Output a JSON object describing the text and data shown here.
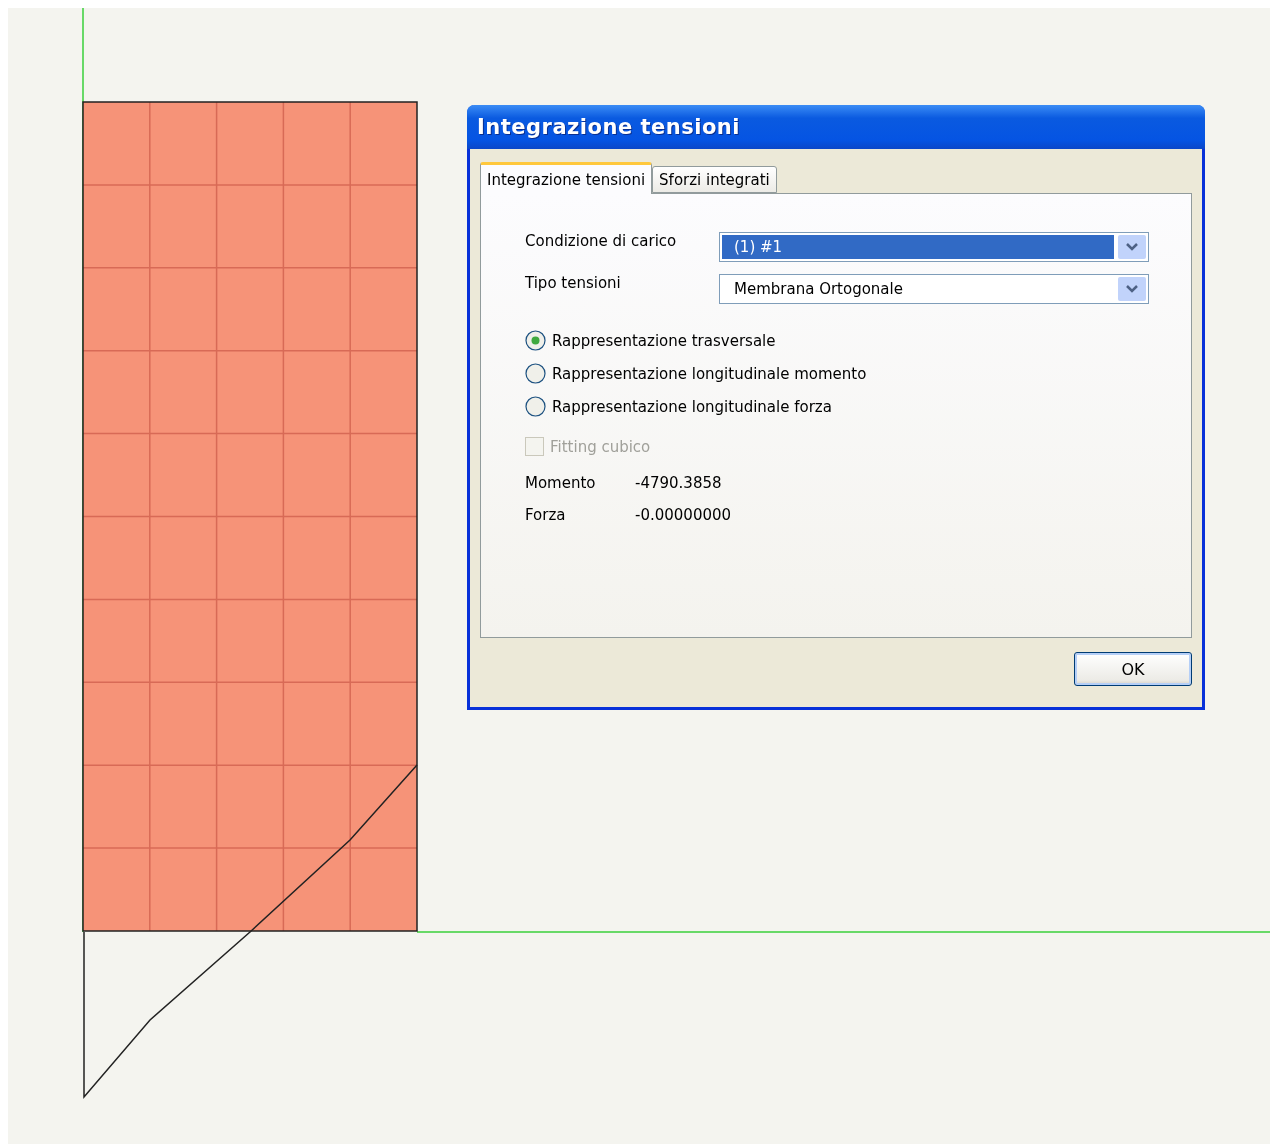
{
  "dialog": {
    "title": "Integrazione tensioni",
    "tabs": [
      {
        "label": "Integrazione tensioni",
        "selected": true
      },
      {
        "label": "Sforzi integrati",
        "selected": false
      }
    ],
    "dropdowns": [
      {
        "label": "Condizione di carico",
        "value": "(1) #1",
        "focused": true
      },
      {
        "label": "Tipo tensioni",
        "value": "Membrana Ortogonale",
        "focused": false
      }
    ],
    "options": [
      {
        "label": "Rappresentazione trasversale",
        "selected": true
      },
      {
        "label": "Rappresentazione longitudinale momento",
        "selected": false
      },
      {
        "label": "Rappresentazione longitudinale forza",
        "selected": false
      }
    ],
    "checkbox": {
      "label": "Fitting cubico",
      "checked": false,
      "disabled": true
    },
    "results": [
      {
        "label": "Momento",
        "value": "-4790.3858"
      },
      {
        "label": "Forza",
        "value": "-0.00000000"
      }
    ],
    "buttons": [
      "OK"
    ]
  }
}
